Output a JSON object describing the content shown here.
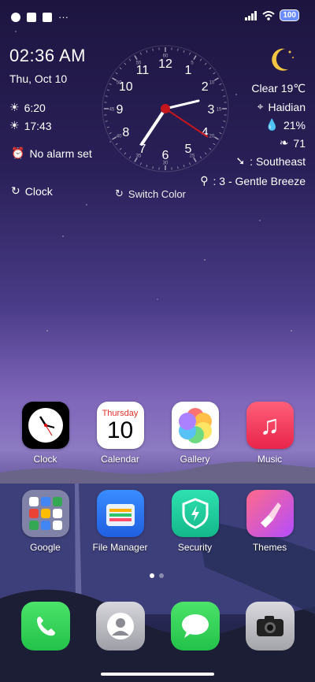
{
  "status": {
    "battery": "100"
  },
  "widget": {
    "time": "02:36 AM",
    "date": "Thu, Oct 10",
    "sunrise": "6:20",
    "sunset": "17:43",
    "alarm": "No alarm set",
    "clock_link": "Clock",
    "switch_color": "Switch Color",
    "clock_numbers": [
      "12",
      "1",
      "2",
      "3",
      "4",
      "5",
      "6",
      "7",
      "8",
      "9",
      "10",
      "11"
    ],
    "clock_small_numbers": [
      "5",
      "10",
      "15",
      "20",
      "25",
      "30",
      "35",
      "40",
      "45",
      "50",
      "55",
      "60"
    ]
  },
  "weather": {
    "condition": "Clear 19℃",
    "location": "Haidian",
    "humidity": "21%",
    "aqi": "71",
    "wind_dir": ": Southeast",
    "wind_speed": ": 3 - Gentle Breeze"
  },
  "apps": [
    {
      "label": "Clock",
      "icon": "clock-icon"
    },
    {
      "label": "Calendar",
      "icon": "calendar-icon",
      "weekday": "Thursday",
      "day": "10"
    },
    {
      "label": "Gallery",
      "icon": "gallery-icon"
    },
    {
      "label": "Music",
      "icon": "music-icon"
    },
    {
      "label": "Google",
      "icon": "google-folder-icon"
    },
    {
      "label": "File Manager",
      "icon": "file-manager-icon"
    },
    {
      "label": "Security",
      "icon": "security-icon"
    },
    {
      "label": "Themes",
      "icon": "themes-icon"
    }
  ],
  "dock": [
    {
      "icon": "phone-icon"
    },
    {
      "icon": "contacts-icon"
    },
    {
      "icon": "messages-icon"
    },
    {
      "icon": "camera-icon"
    }
  ]
}
